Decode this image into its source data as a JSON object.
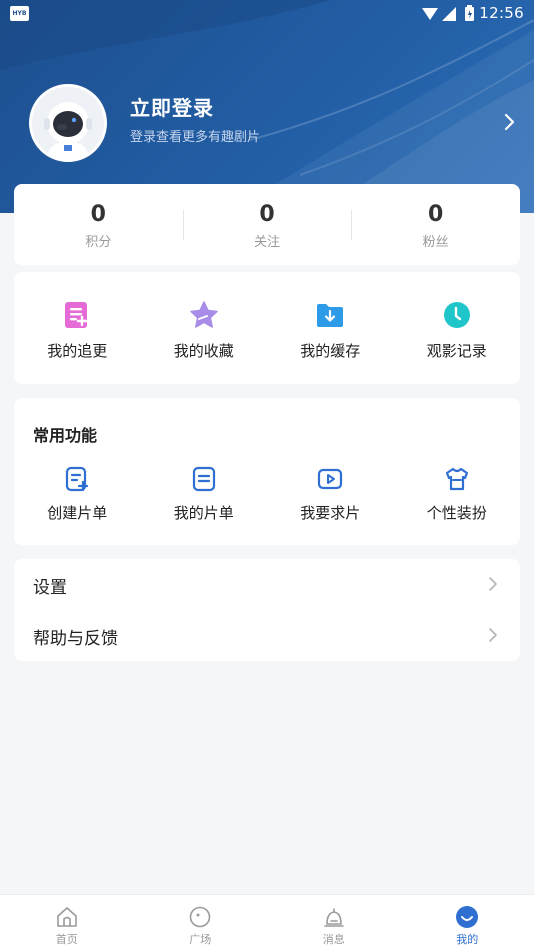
{
  "status_bar": {
    "time": "12:56",
    "app_icon_text": "HYB"
  },
  "profile": {
    "title": "立即登录",
    "subtitle": "登录查看更多有趣剧片"
  },
  "stats": [
    {
      "value": "0",
      "label": "积分"
    },
    {
      "value": "0",
      "label": "关注"
    },
    {
      "value": "0",
      "label": "粉丝"
    }
  ],
  "quick_actions": [
    {
      "label": "我的追更",
      "icon": "list-plus-icon",
      "color": "#e56bd6"
    },
    {
      "label": "我的收藏",
      "icon": "star-icon",
      "color": "#a98be8"
    },
    {
      "label": "我的缓存",
      "icon": "folder-download-icon",
      "color": "#2e9be8"
    },
    {
      "label": "观影记录",
      "icon": "clock-icon",
      "color": "#1fc6c9"
    }
  ],
  "common_functions": {
    "title": "常用功能",
    "items": [
      {
        "label": "创建片单",
        "icon": "create-list-icon"
      },
      {
        "label": "我的片单",
        "icon": "list-icon"
      },
      {
        "label": "我要求片",
        "icon": "play-request-icon"
      },
      {
        "label": "个性装扮",
        "icon": "shirt-icon"
      }
    ]
  },
  "menu": [
    {
      "label": "设置"
    },
    {
      "label": "帮助与反馈"
    }
  ],
  "bottom_nav": [
    {
      "label": "首页",
      "icon": "home-icon",
      "active": false
    },
    {
      "label": "广场",
      "icon": "plaza-icon",
      "active": false
    },
    {
      "label": "消息",
      "icon": "bell-icon",
      "active": false
    },
    {
      "label": "我的",
      "icon": "profile-icon",
      "active": true
    }
  ],
  "colors": {
    "header": "#225ea5",
    "accent": "#2f6fd1",
    "icon_blue": "#2f6fd1"
  }
}
